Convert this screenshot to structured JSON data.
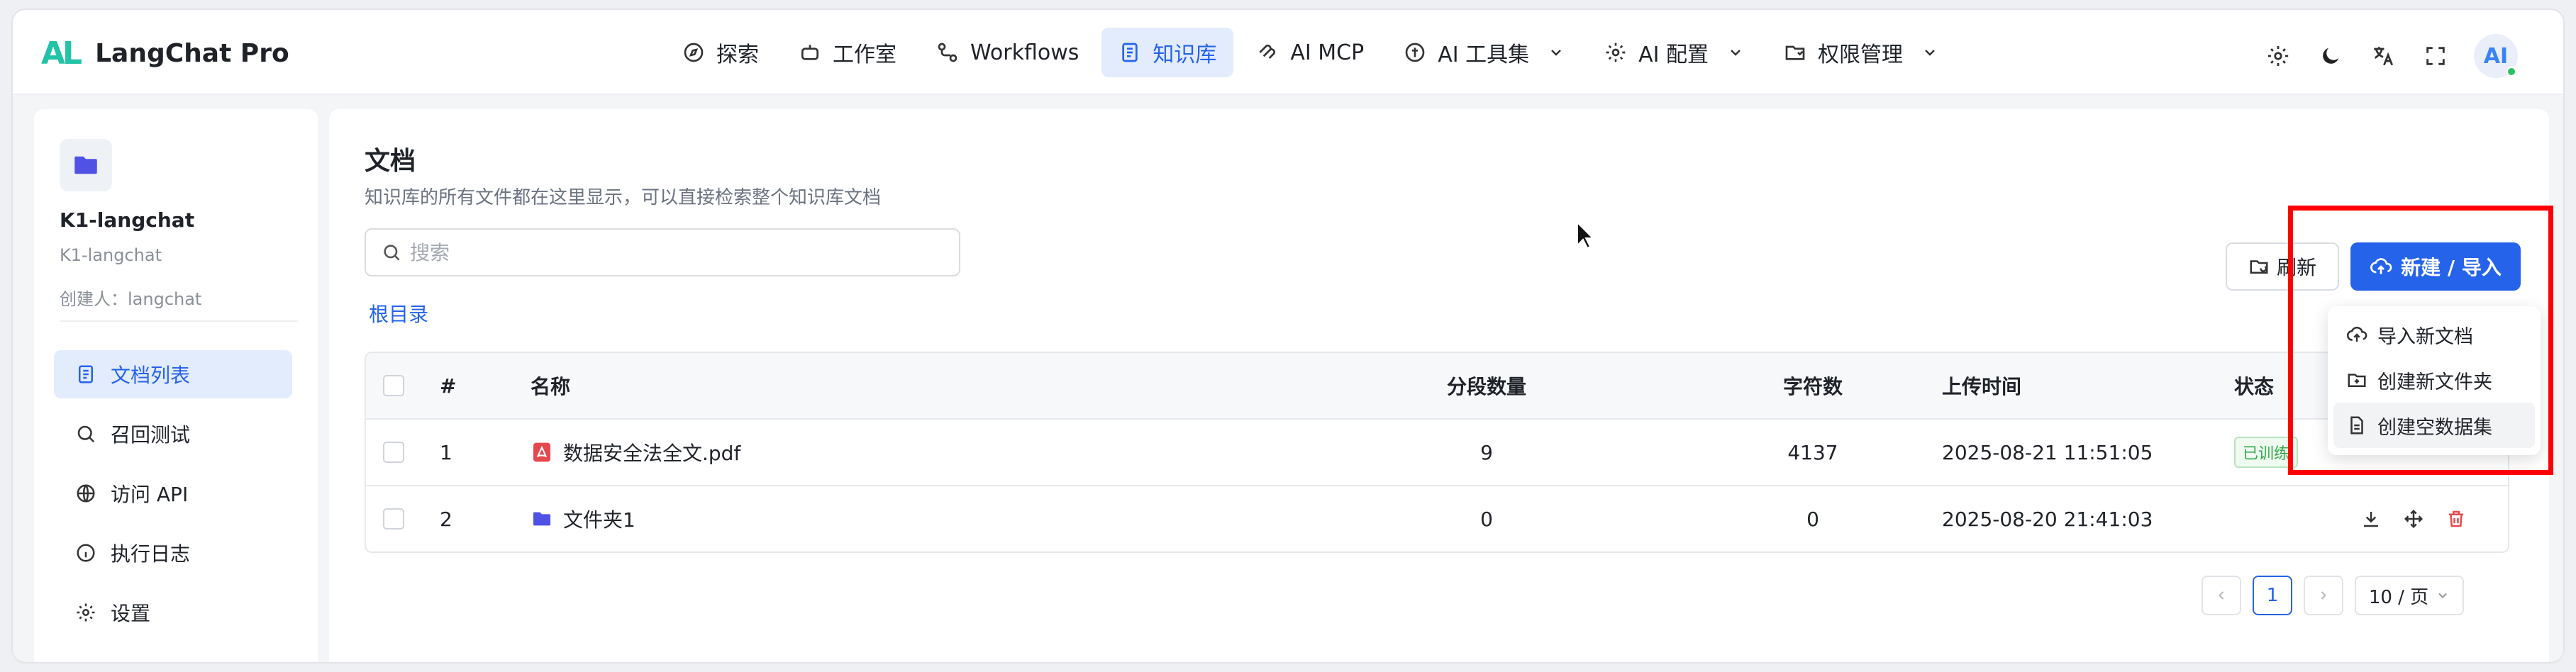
{
  "app": {
    "logo_mark": "AL",
    "name": "LangChat Pro"
  },
  "nav": {
    "items": [
      {
        "label": "探索",
        "icon": "compass-icon"
      },
      {
        "label": "工作室",
        "icon": "bot-icon"
      },
      {
        "label": "Workflows",
        "icon": "workflow-icon"
      },
      {
        "label": "知识库",
        "icon": "book-icon",
        "active": true
      },
      {
        "label": "AI MCP",
        "icon": "mcp-icon"
      },
      {
        "label": "AI 工具集",
        "icon": "tool-icon",
        "dropdown": true
      },
      {
        "label": "AI 配置",
        "icon": "gear-icon",
        "dropdown": true
      },
      {
        "label": "权限管理",
        "icon": "shield-folder-icon",
        "dropdown": true
      }
    ]
  },
  "header_icons": [
    "gear-icon",
    "moon-icon",
    "translate-icon",
    "fullscreen-icon"
  ],
  "avatar": {
    "text": "AI"
  },
  "sidebar": {
    "kb_name": "K1-langchat",
    "kb_sub": "K1-langchat",
    "creator": "创建人：langchat",
    "menu": [
      {
        "label": "文档列表",
        "icon": "document-list-icon",
        "active": true
      },
      {
        "label": "召回测试",
        "icon": "search-icon"
      },
      {
        "label": "访问 API",
        "icon": "globe-icon"
      },
      {
        "label": "执行日志",
        "icon": "info-icon"
      },
      {
        "label": "设置",
        "icon": "gear-icon"
      }
    ]
  },
  "main": {
    "title": "文档",
    "description": "知识库的所有文件都在这里显示，可以直接检索整个知识库文档",
    "search_placeholder": "搜索",
    "breadcrumb": "根目录",
    "refresh_label": "刷新",
    "new_label": "新建 / 导入"
  },
  "table": {
    "headers": {
      "num": "#",
      "name": "名称",
      "segments": "分段数量",
      "chars": "字符数",
      "time": "上传时间",
      "status": "状态"
    },
    "rows": [
      {
        "num": "1",
        "name": "数据安全法全文.pdf",
        "type": "pdf",
        "segments": "9",
        "chars": "4137",
        "time": "2025-08-21 11:51:05",
        "status": "已训练"
      },
      {
        "num": "2",
        "name": "文件夹1",
        "type": "folder",
        "segments": "0",
        "chars": "0",
        "time": "2025-08-20 21:41:03",
        "status": ""
      }
    ]
  },
  "pagination": {
    "current": "1",
    "page_size": "10 / 页"
  },
  "dropdown": {
    "items": [
      {
        "label": "导入新文档",
        "icon": "cloud-upload-icon"
      },
      {
        "label": "创建新文件夹",
        "icon": "folder-plus-icon"
      },
      {
        "label": "创建空数据集",
        "icon": "file-icon",
        "hover": true
      }
    ]
  },
  "colors": {
    "accent": "#2563eb",
    "highlight": "#ff0000",
    "success": "#36a94a",
    "pdf": "#e5484d",
    "folder": "#4f52e5"
  }
}
